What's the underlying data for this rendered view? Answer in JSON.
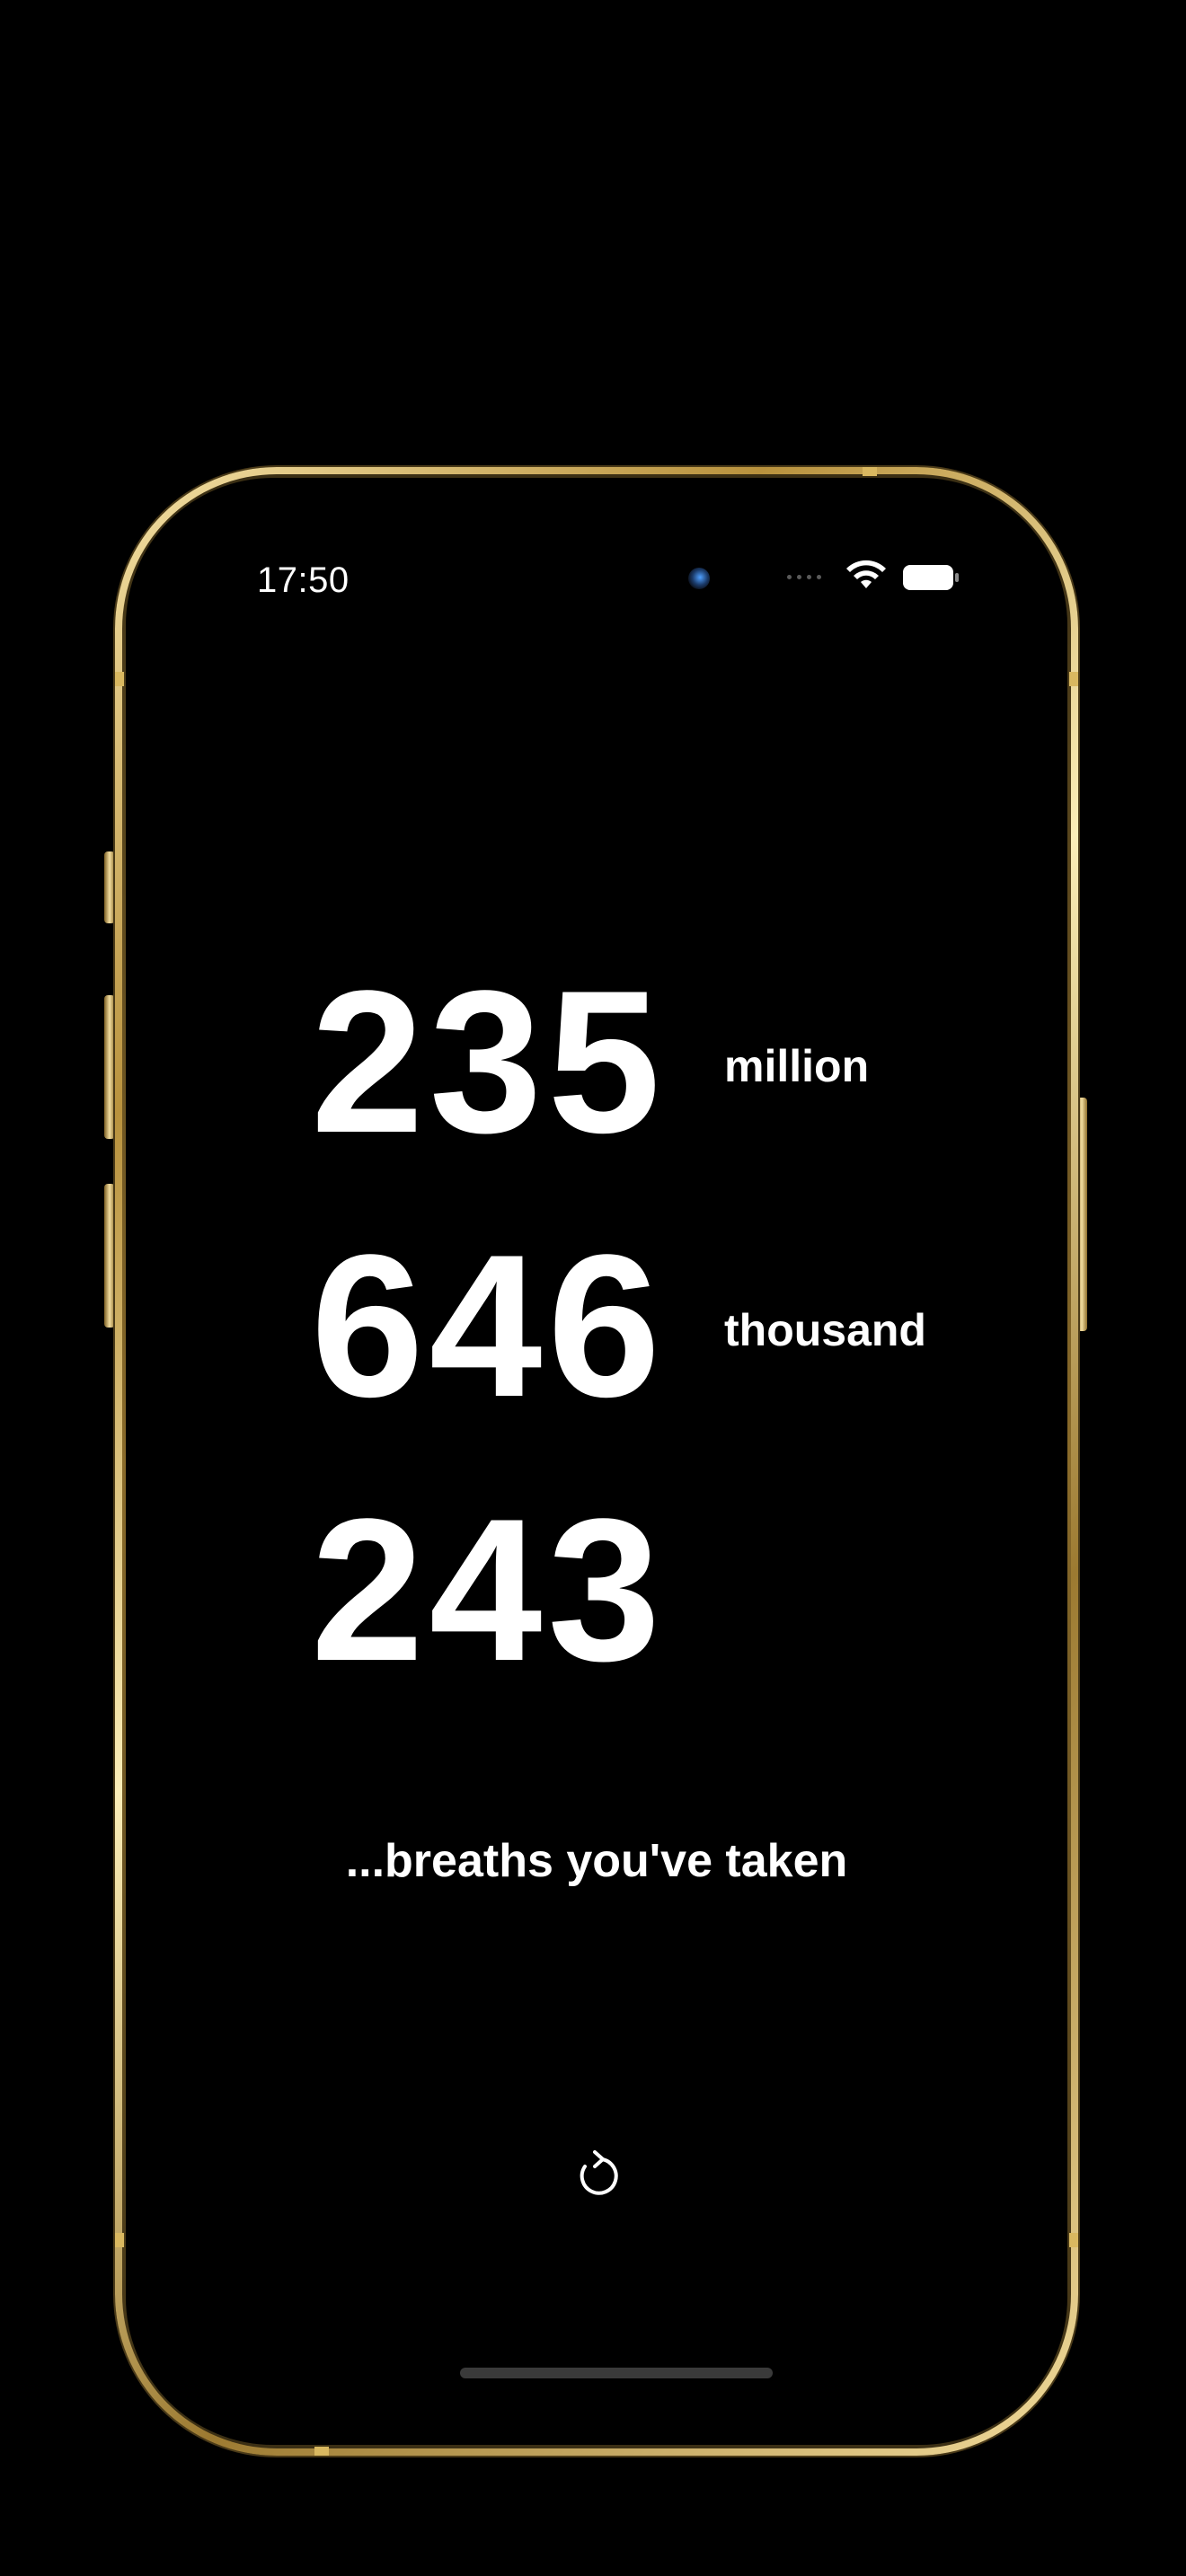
{
  "status_bar": {
    "time": "17:50",
    "icons": [
      "front-camera-icon",
      "cellular-signal-icon",
      "wifi-icon",
      "battery-icon"
    ]
  },
  "breath_counter": {
    "rows": [
      {
        "digits": "235",
        "unit": "million"
      },
      {
        "digits": "646",
        "unit": "thousand"
      },
      {
        "digits": "243",
        "unit": ""
      }
    ],
    "caption": "...breaths you've taken"
  },
  "actions": {
    "refresh_icon": "refresh-icon"
  },
  "colors": {
    "background": "#000000",
    "text": "#ffffff",
    "frame_gold": "#d9b860",
    "home_indicator": "#3a3a3a"
  }
}
